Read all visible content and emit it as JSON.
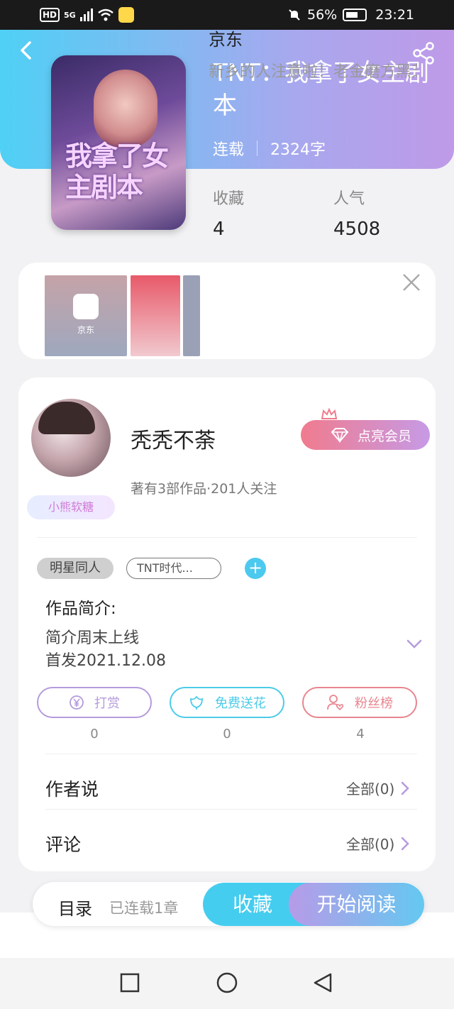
{
  "statusbar": {
    "hd": "HD",
    "network": "5G",
    "battery_pct": "56%",
    "time": "23:21"
  },
  "book": {
    "title": "TNT：我拿了女主剧本",
    "cover_text": "我拿了女主剧本",
    "status": "连载",
    "word_count": "2324字",
    "stats": [
      {
        "label": "收藏",
        "value": "4"
      },
      {
        "label": "人气",
        "value": "4508"
      }
    ]
  },
  "ad": {
    "title": "京东",
    "desc": "新乡的人注意啦！老金磨方黑芝麻丸，超值优惠进行中",
    "thumb_label": "京东"
  },
  "author": {
    "name": "秃秃不荼",
    "sub": "著有3部作品·201人关注",
    "badge": "小熊软糖",
    "vip_label": "点亮会员"
  },
  "tags": {
    "primary": "明星同人",
    "secondary": "TNT时代...",
    "add": "+"
  },
  "intro": {
    "label": "作品简介:",
    "line1": "简介周末上线",
    "line2": "首发2021.12.08"
  },
  "actions": [
    {
      "label": "打赏",
      "count": "0",
      "icon": "yen-icon",
      "color": "#b59bdc"
    },
    {
      "label": "免费送花",
      "count": "0",
      "icon": "flower-icon",
      "color": "#4ccbe8"
    },
    {
      "label": "粉丝榜",
      "count": "4",
      "icon": "user-heart-icon",
      "color": "#e8858f"
    }
  ],
  "rows": [
    {
      "label": "作者说",
      "right": "全部(0)"
    },
    {
      "label": "评论",
      "right": "全部(0)"
    }
  ],
  "bottom": {
    "toc": "目录",
    "chapters": "已连载1章",
    "collect": "收藏",
    "read": "开始阅读"
  }
}
